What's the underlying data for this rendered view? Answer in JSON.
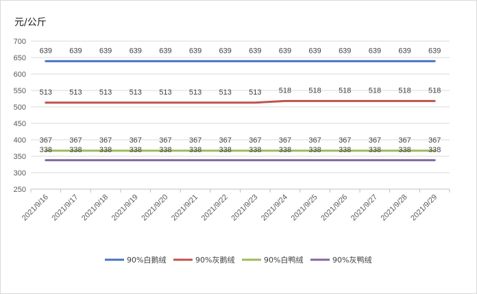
{
  "chart_data": {
    "type": "line",
    "unit_label": "元/公斤",
    "categories": [
      "2021/9/16",
      "2021/9/17",
      "2021/9/18",
      "2021/9/19",
      "2021/9/20",
      "2021/9/21",
      "2021/9/22",
      "2021/9/23",
      "2021/9/24",
      "2021/9/25",
      "2021/9/26",
      "2021/9/27",
      "2021/9/28",
      "2021/9/29"
    ],
    "ylim": [
      250,
      700
    ],
    "yticks": [
      250,
      300,
      350,
      400,
      450,
      500,
      550,
      600,
      650,
      700
    ],
    "grid": true,
    "legend_position": "bottom",
    "series": [
      {
        "name": "90%白鹅绒",
        "color": "#4472c4",
        "values": [
          639,
          639,
          639,
          639,
          639,
          639,
          639,
          639,
          639,
          639,
          639,
          639,
          639,
          639
        ]
      },
      {
        "name": "90%灰鹅绒",
        "color": "#c0504d",
        "values": [
          513,
          513,
          513,
          513,
          513,
          513,
          513,
          513,
          518,
          518,
          518,
          518,
          518,
          518
        ]
      },
      {
        "name": "90%白鸭绒",
        "color": "#9bbb59",
        "values": [
          367,
          367,
          367,
          367,
          367,
          367,
          367,
          367,
          367,
          367,
          367,
          367,
          367,
          367
        ]
      },
      {
        "name": "90%灰鸭绒",
        "color": "#8064a2",
        "values": [
          338,
          338,
          338,
          338,
          338,
          338,
          338,
          338,
          338,
          338,
          338,
          338,
          338,
          338
        ]
      }
    ]
  }
}
